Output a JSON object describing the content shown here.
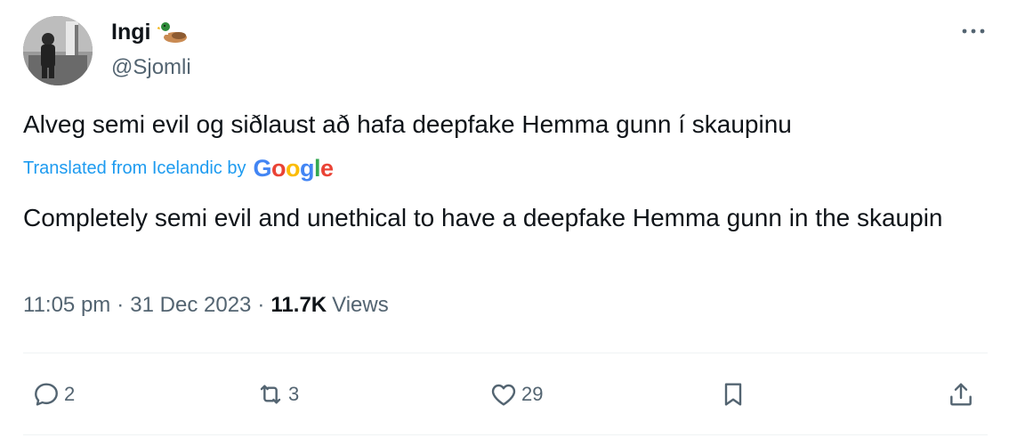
{
  "author": {
    "name": "Ingi",
    "handle": "@Sjomli"
  },
  "tweet": {
    "original_text": "Alveg semi evil og siðlaust að hafa deepfake Hemma gunn í skaupinu",
    "translated_label": "Translated from Icelandic by",
    "translation_provider": "Google",
    "translated_text": "Completely semi evil and unethical to have a deepfake Hemma gunn in the skaupin",
    "time": "11:05 pm",
    "date": "31 Dec 2023",
    "separator": "·",
    "views_count": "11.7K",
    "views_label": "Views"
  },
  "actions": {
    "replies": "2",
    "retweets": "3",
    "likes": "29"
  },
  "icons": {
    "more": "more-icon",
    "reply": "reply-icon",
    "retweet": "retweet-icon",
    "like": "heart-icon",
    "bookmark": "bookmark-icon",
    "share": "share-icon"
  },
  "colors": {
    "link": "#1d9bf0",
    "secondary_text": "#536471",
    "primary_text": "#0f1419"
  }
}
